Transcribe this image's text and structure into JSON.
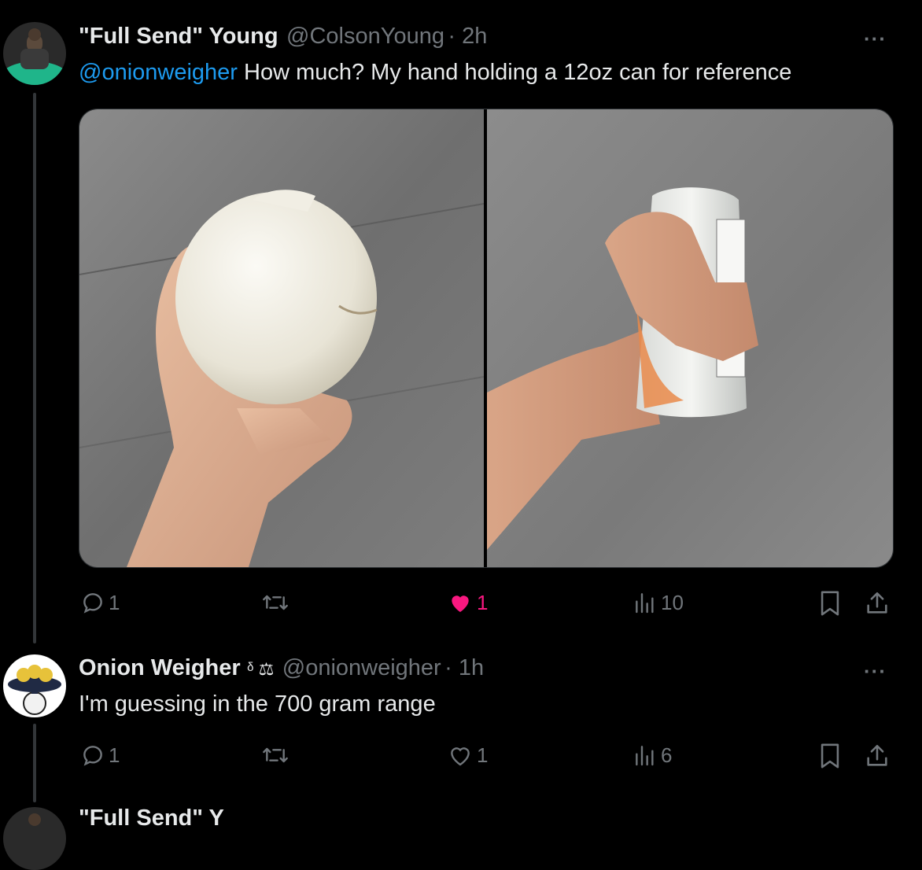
{
  "tweet1": {
    "display_name": "\"Full Send\" Young",
    "handle": "@ColsonYoung",
    "time": "· 2h",
    "mention": "@onionweigher",
    "text": " How much? My hand holding a 12oz can for reference",
    "media": [
      "onion-in-hand-photo",
      "can-in-hand-photo"
    ],
    "stats": {
      "replies": "1",
      "reposts": "",
      "likes": "1",
      "views": "10"
    },
    "liked": true
  },
  "tweet2": {
    "display_name": "Onion Weigher",
    "badges": "ᵟ ⚖",
    "handle": "@onionweigher",
    "time": "· 1h",
    "text": "I'm guessing in the 700 gram range",
    "stats": {
      "replies": "1",
      "reposts": "",
      "likes": "1",
      "views": "6"
    },
    "liked": false
  },
  "tweet3": {
    "display_name": "\"Full Send\" Y"
  },
  "colors": {
    "accent": "#1d9bf0",
    "like": "#f91880",
    "muted": "#71767b",
    "text": "#e7e9ea",
    "bg": "#000000"
  },
  "icons": [
    "reply-icon",
    "repost-icon",
    "like-icon",
    "views-icon",
    "bookmark-icon",
    "share-icon",
    "more-icon"
  ]
}
